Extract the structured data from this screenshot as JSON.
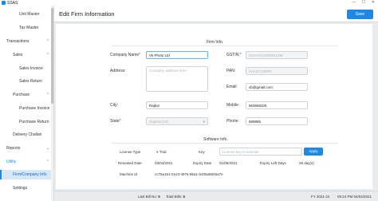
{
  "app": {
    "name": "SSAS"
  },
  "window_controls": {
    "minimize": "—",
    "maximize": "☐",
    "close": "✕"
  },
  "sidebar": {
    "items": [
      {
        "label": "Unit Master"
      },
      {
        "label": "Tax Master"
      },
      {
        "label": "Transactions"
      },
      {
        "label": "Sales"
      },
      {
        "label": "Sales Invoice"
      },
      {
        "label": "Sales Return"
      },
      {
        "label": "Purchase"
      },
      {
        "label": "Purchase Invoice"
      },
      {
        "label": "Purchase Return"
      },
      {
        "label": "Delivery Challan"
      },
      {
        "label": "Reports"
      },
      {
        "label": "Utility"
      },
      {
        "label": "Firm/Company Info"
      },
      {
        "label": "Settings"
      }
    ]
  },
  "header": {
    "title": "Edit Firm Information",
    "save_label": "Save"
  },
  "firm_info": {
    "section_title": "Firm Info.",
    "company_name": {
      "label": "Company Name",
      "value": "Vk Photo Ltd"
    },
    "address": {
      "label": "Address:",
      "placeholder": "Company address here"
    },
    "city": {
      "label": "City:",
      "value": "Rajkot"
    },
    "state": {
      "label": "State",
      "value": "Gujarat (24)"
    },
    "gstin": {
      "label": "GSTIN:",
      "value": "24AAACC0000X1ZM"
    },
    "pan": {
      "label": "PAN:",
      "value": "AAACC1000X"
    },
    "email": {
      "label": "Email:",
      "value": "vb@gmail.com"
    },
    "mobile": {
      "label": "Mobile:",
      "value": "963656325"
    },
    "phone": {
      "label": "Phone:",
      "value": "659865"
    }
  },
  "software_info": {
    "section_title": "Software Info.",
    "license_type": {
      "label": "License Type",
      "value": "Trial"
    },
    "key": {
      "label": "Key",
      "placeholder": "License key to activate"
    },
    "apply_label": "Apply",
    "renewed_date": {
      "label": "Renewed Date",
      "value": "03/04/2021"
    },
    "expiry_date": {
      "label": "Expiry Date",
      "value": "01/05/2021"
    },
    "expiry_left_days": {
      "label": "Expiry Left Days",
      "value": "26 day(s)"
    },
    "machine_id": {
      "label": "Machine Id",
      "value": "cc76a161-01e3-4976-9ba1-b405a5845a7e"
    }
  },
  "status_bar": {
    "last_bill_label": "Last Bill No:",
    "last_bill_value": "5",
    "total_bills_label": "Total Bills:",
    "total_bills_value": "5",
    "fy": "FY 2021-22",
    "time": "09:24 PM 04/04/2021"
  },
  "colors": {
    "accent": "#1e88e5",
    "sidebar_active": "#d6e8f8",
    "background": "#e9ecef"
  }
}
